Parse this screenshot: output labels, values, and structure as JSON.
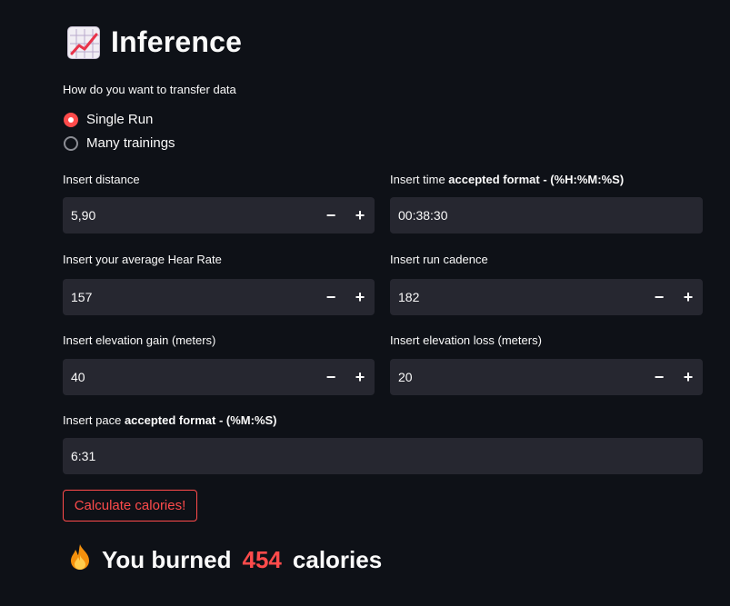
{
  "title": "Inference",
  "transfer_question": "How do you want to transfer data",
  "transfer_options": [
    {
      "label": "Single Run",
      "selected": true
    },
    {
      "label": "Many trainings",
      "selected": false
    }
  ],
  "fields": {
    "distance": {
      "label": "Insert distance",
      "value": "5,90"
    },
    "time": {
      "label_prefix": "Insert time ",
      "label_bold": "accepted format - (%H:%M:%S)",
      "value": "00:38:30"
    },
    "heart_rate": {
      "label": "Insert your average Hear Rate",
      "value": "157"
    },
    "cadence": {
      "label": "Insert run cadence",
      "value": "182"
    },
    "elev_gain": {
      "label": "Insert elevation gain (meters)",
      "value": "40"
    },
    "elev_loss": {
      "label": "Insert elevation loss (meters)",
      "value": "20"
    },
    "pace": {
      "label_prefix": "Insert pace ",
      "label_bold": "accepted format - (%M:%S)",
      "value": "6:31"
    }
  },
  "stepper": {
    "minus": "−",
    "plus": "+"
  },
  "calc_button": "Calculate calories!",
  "result": {
    "prefix": "You burned",
    "value": "454",
    "suffix": "calories"
  },
  "icons": {
    "title": "chart-increasing-icon",
    "result": "fire-icon"
  },
  "colors": {
    "accent": "#ff4b4b",
    "background": "#0e1117",
    "input_bg": "#262730"
  }
}
